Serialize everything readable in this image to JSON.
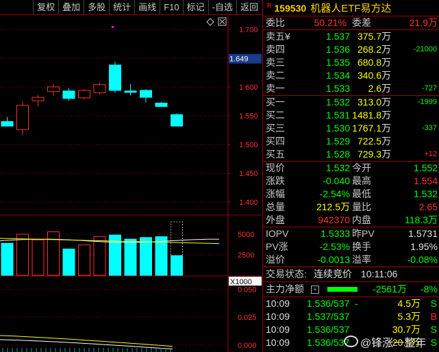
{
  "toolbar": [
    "复权",
    "叠加",
    "多股",
    "统计",
    "画线",
    "F10",
    "标记",
    "-自选",
    "返回"
  ],
  "security": {
    "flag": "R",
    "code": "159530",
    "name": "机器人ETF易方达"
  },
  "weibi": {
    "label": "委比",
    "value": "50.21%",
    "diff_label": "委差",
    "diff": "21.9万"
  },
  "asks": [
    {
      "label": "卖五",
      "mark": "¥",
      "price": "1.537",
      "vol": "375.7",
      "unit": "万",
      "chg": ""
    },
    {
      "label": "卖四",
      "mark": "",
      "price": "1.536",
      "vol": "268.2",
      "unit": "万",
      "chg": "-21000"
    },
    {
      "label": "卖三",
      "mark": "",
      "price": "1.535",
      "vol": "680.8",
      "unit": "万",
      "chg": ""
    },
    {
      "label": "卖二",
      "mark": "",
      "price": "1.534",
      "vol": "340.6",
      "unit": "万",
      "chg": ""
    },
    {
      "label": "卖一",
      "mark": "",
      "price": "1.533",
      "vol": "2.6",
      "unit": "万",
      "chg": "-727"
    }
  ],
  "bids": [
    {
      "label": "买一",
      "price": "1.532",
      "vol": "313.0",
      "unit": "万",
      "chg": "-1999"
    },
    {
      "label": "买二",
      "price": "1.531",
      "vol": "1481.8",
      "unit": "万",
      "chg": ""
    },
    {
      "label": "买三",
      "price": "1.530",
      "vol": "1767.1",
      "unit": "万",
      "chg": "-337"
    },
    {
      "label": "买四",
      "price": "1.529",
      "vol": "722.5",
      "unit": "万",
      "chg": ""
    },
    {
      "label": "买五",
      "price": "1.528",
      "vol": "729.3",
      "unit": "万",
      "chg": "+12"
    }
  ],
  "stats": [
    {
      "l1": "现价",
      "v1": "1.532",
      "l2": "今开",
      "v2": "1.552"
    },
    {
      "l1": "涨跌",
      "v1": "-0.040",
      "l2": "最高",
      "v2": "1.554"
    },
    {
      "l1": "涨幅",
      "v1": "-2.54%",
      "l2": "最低",
      "v2": "1.532"
    },
    {
      "l1": "总量",
      "v1": "212.5万",
      "l2": "量比",
      "v2": "2.65"
    },
    {
      "l1": "外盘",
      "v1": "942370",
      "l2": "内盘",
      "v2": "118.3万"
    }
  ],
  "iopv": [
    {
      "l1": "IOPV",
      "v1": "1.5333",
      "l2": "昨PV",
      "v2": "1.5731"
    },
    {
      "l1": "PV涨",
      "v1": "-2.53%",
      "l2": "换手",
      "v2": "1.95%"
    },
    {
      "l1": "溢价",
      "v1": "-0.0013",
      "l2": "溢率",
      "v2": "-0.08%"
    }
  ],
  "trade_status": {
    "label": "交易状态:",
    "value": "连续竞价",
    "time": "10:11:06"
  },
  "net_flow": {
    "label": "主力净额",
    "value": "-2561万",
    "pct": "-8%"
  },
  "ticks": [
    {
      "time": "10:09",
      "price": "1.536/537",
      "tag": "-",
      "vol": "4.5万",
      "side": "S"
    },
    {
      "time": "10:09",
      "price": "1.537/537",
      "tag": "",
      "vol": "5.3万",
      "side": "B"
    },
    {
      "time": "10:09",
      "price": "1.536/537",
      "tag": "",
      "vol": "30.7万",
      "side": "S"
    },
    {
      "time": "10:09",
      "price": "1.536/537",
      "tag": "",
      "vol": "20.9万",
      "side": "S"
    }
  ],
  "watermark": "@锋涨一整年",
  "price_axis": {
    "ticks": [
      "1.700",
      "1.650",
      "1.600",
      "1.550",
      "1.500",
      "1.450",
      "1.400"
    ],
    "current": "1.649"
  },
  "volume_axis": {
    "ticks": [
      "5000",
      "2500"
    ],
    "unit": "X1000"
  },
  "flow_axis": {
    "ticks": [
      "0.050",
      "0.025",
      "0.000"
    ]
  },
  "colors": {
    "up": "#ff3030",
    "down": "#00ffff",
    "grid": "#a00000",
    "axis_text": "#ff3030"
  },
  "chart_data": {
    "type": "candlestick",
    "candles": [
      {
        "o": 1.54,
        "h": 1.548,
        "l": 1.532,
        "c": 1.532,
        "dir": "down"
      },
      {
        "o": 1.526,
        "h": 1.575,
        "l": 1.516,
        "c": 1.568,
        "dir": "up"
      },
      {
        "o": 1.576,
        "h": 1.586,
        "l": 1.566,
        "c": 1.582,
        "dir": "up"
      },
      {
        "o": 1.592,
        "h": 1.605,
        "l": 1.585,
        "c": 1.6,
        "dir": "up"
      },
      {
        "o": 1.593,
        "h": 1.598,
        "l": 1.576,
        "c": 1.58,
        "dir": "down"
      },
      {
        "o": 1.581,
        "h": 1.596,
        "l": 1.578,
        "c": 1.594,
        "dir": "up"
      },
      {
        "o": 1.59,
        "h": 1.608,
        "l": 1.587,
        "c": 1.604,
        "dir": "up"
      },
      {
        "o": 1.638,
        "h": 1.644,
        "l": 1.59,
        "c": 1.594,
        "dir": "down"
      },
      {
        "o": 1.592,
        "h": 1.605,
        "l": 1.585,
        "c": 1.593,
        "dir": "down"
      },
      {
        "o": 1.594,
        "h": 1.596,
        "l": 1.573,
        "c": 1.582,
        "dir": "down"
      },
      {
        "o": 1.572,
        "h": 1.574,
        "l": 1.566,
        "c": 1.566,
        "dir": "down"
      },
      {
        "o": 1.552,
        "h": 1.554,
        "l": 1.532,
        "c": 1.532,
        "dir": "down"
      }
    ],
    "volumes": [
      3900,
      5000,
      4300,
      5300,
      3200,
      3700,
      4700,
      4900,
      4400,
      4600,
      4700,
      2400
    ],
    "ylim": [
      1.38,
      1.72
    ]
  }
}
